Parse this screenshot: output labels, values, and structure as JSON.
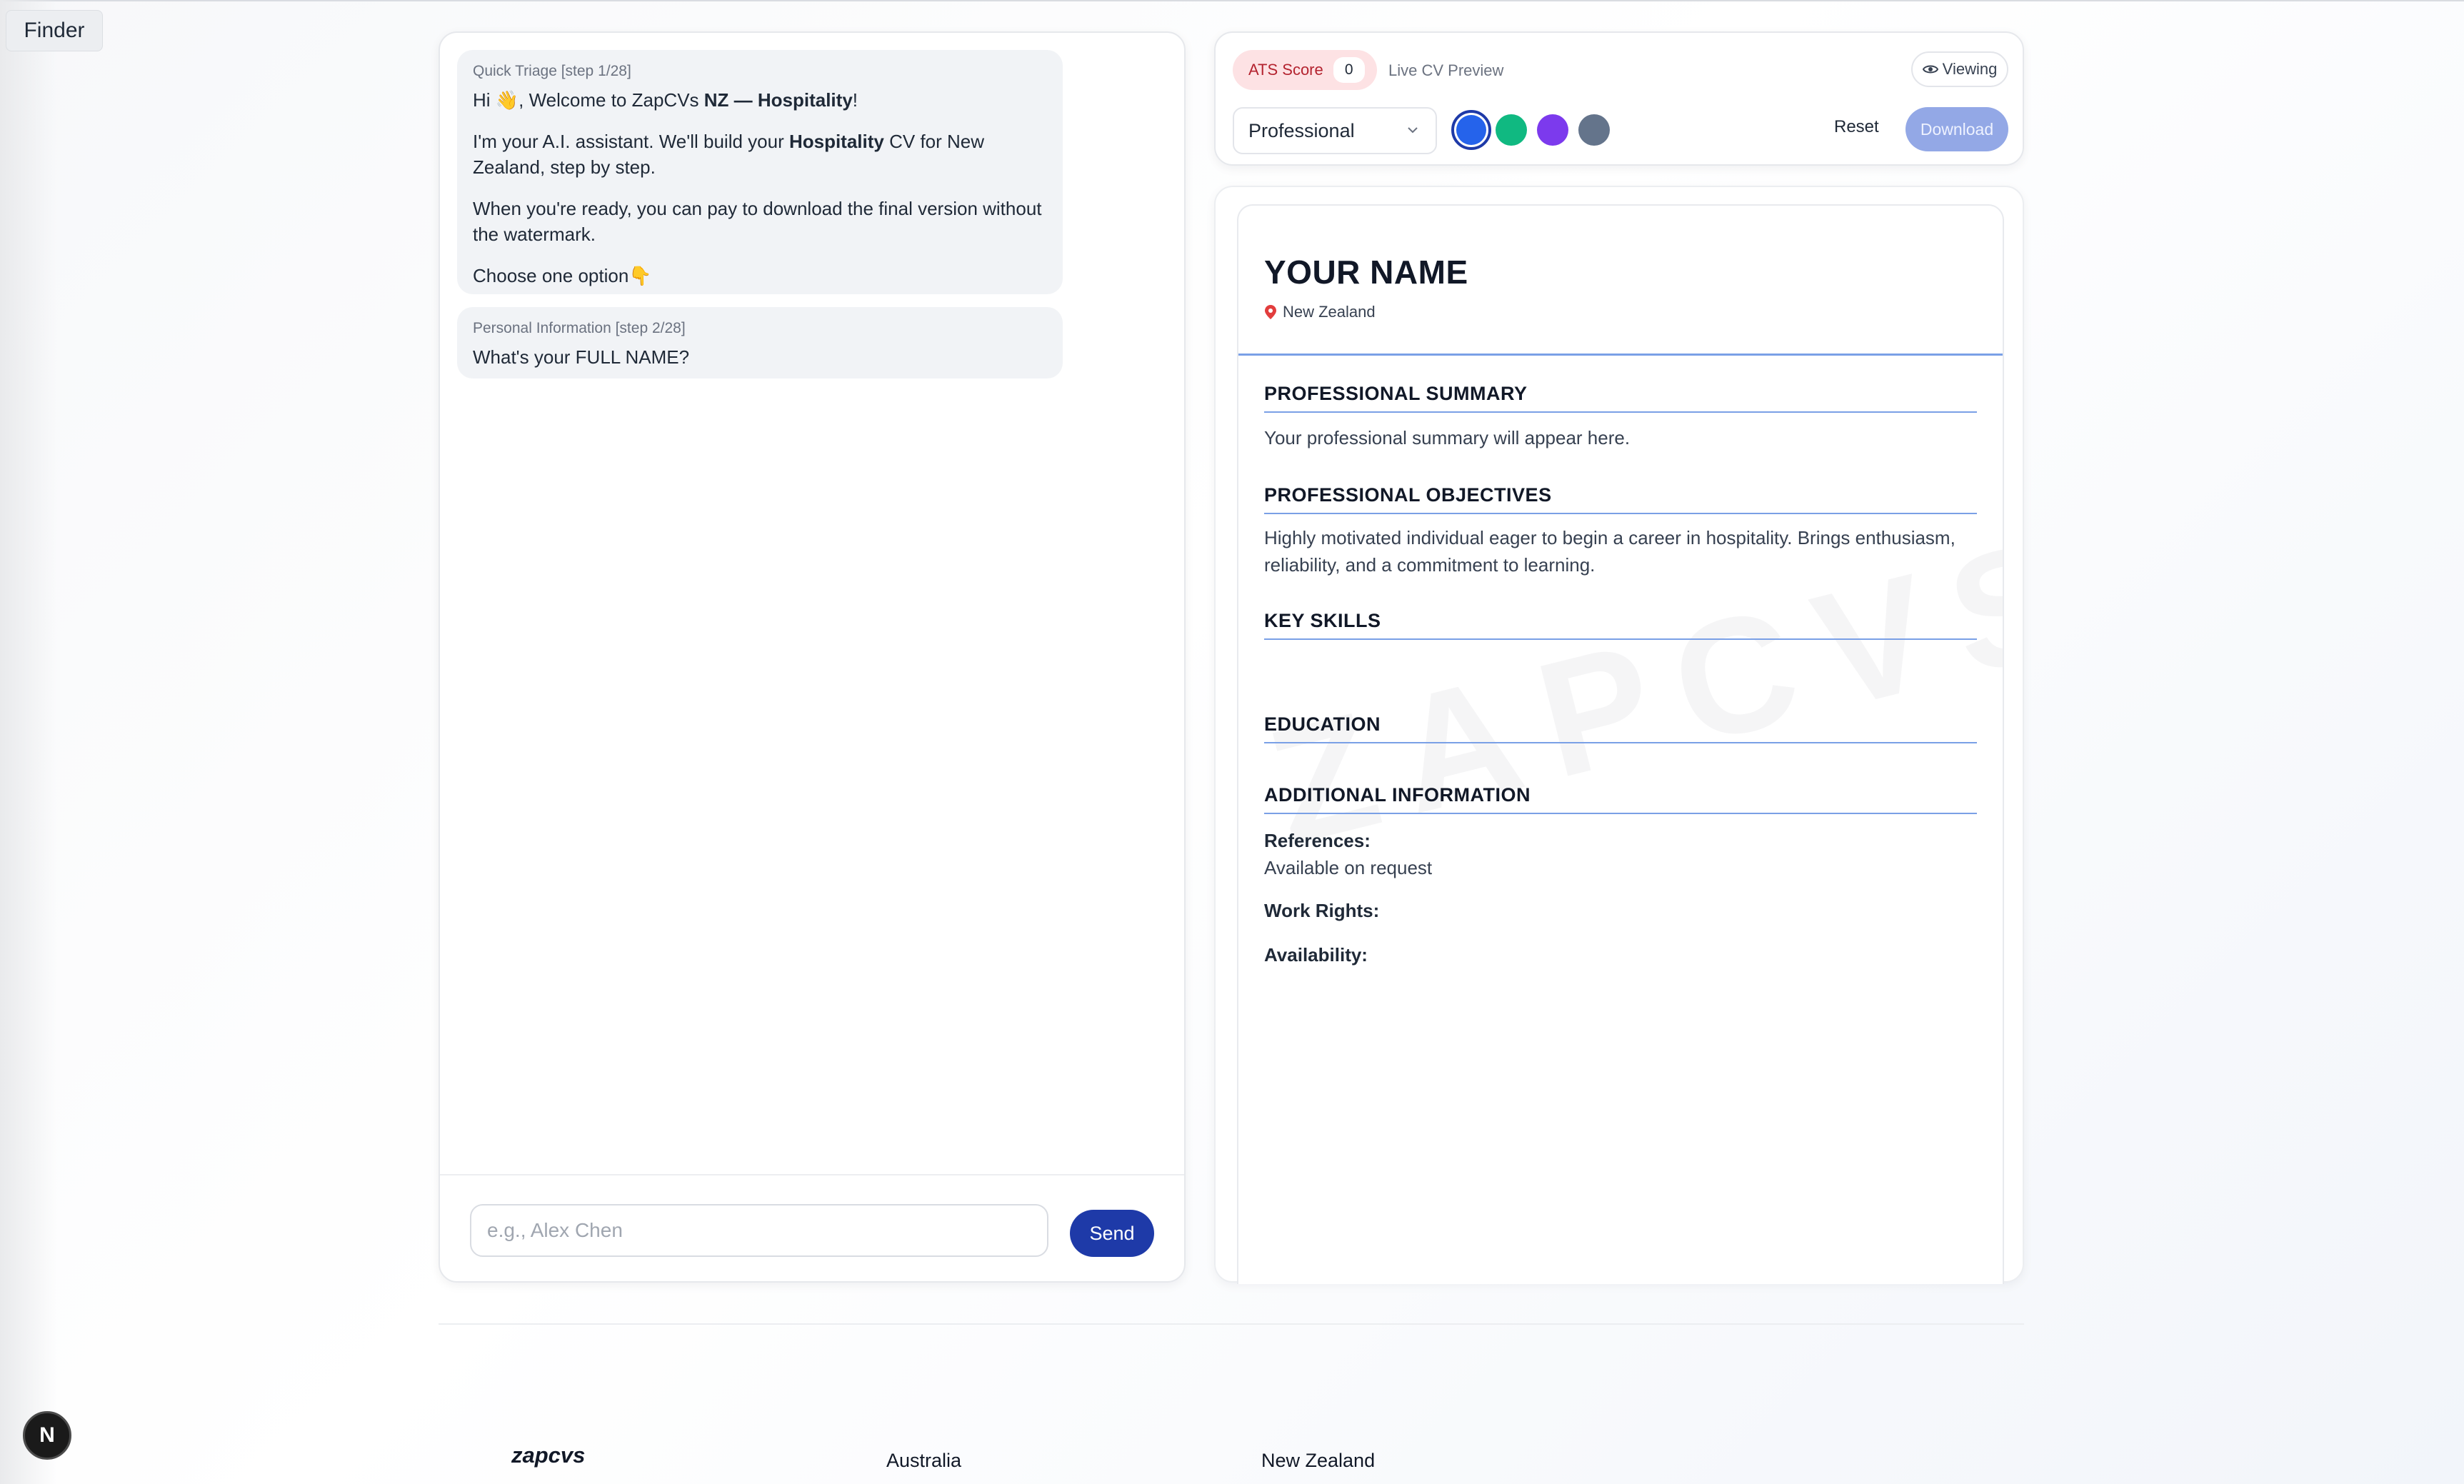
{
  "system": {
    "finder_label": "Finder"
  },
  "chat": {
    "messages": [
      {
        "step": "Quick Triage [step 1/28]",
        "greeting_pre": "Hi 👋, Welcome to ZapCVs ",
        "greeting_bold": "NZ — Hospitality",
        "greeting_post": "!",
        "line2_pre": "I'm your A.I. assistant. We'll build your ",
        "line2_bold": "Hospitality",
        "line2_post": " CV for New Zealand, step by step.",
        "line3": "When you're ready, you can pay to download the final version without the watermark.",
        "line4": "Choose one option👇"
      },
      {
        "step": "Personal Information [step 2/28]",
        "question": "What's your FULL NAME?"
      }
    ],
    "input_placeholder": "e.g., Alex Chen",
    "input_value": "",
    "send_label": "Send"
  },
  "toolbar": {
    "ats_label": "ATS Score",
    "ats_score": "0",
    "live_label": "Live CV Preview",
    "viewing_label": "Viewing",
    "template_selected": "Professional",
    "colors": [
      "#2563eb",
      "#10b981",
      "#7c3aed",
      "#64748b"
    ],
    "selected_color": "#2563eb",
    "reset_label": "Reset",
    "download_label": "Download"
  },
  "cv": {
    "name": "YOUR NAME",
    "location": "New Zealand",
    "watermark": "ZAPCVS",
    "summary_title": "PROFESSIONAL SUMMARY",
    "summary_text": "Your professional summary will appear here.",
    "objectives_title": "PROFESSIONAL OBJECTIVES",
    "objectives_text": "Highly motivated individual eager to begin a career in hospitality. Brings enthusiasm, reliability, and a commitment to learning.",
    "skills_title": "KEY SKILLS",
    "education_title": "EDUCATION",
    "additional_title": "ADDITIONAL INFORMATION",
    "references_label": "References:",
    "references_value": "Available on request",
    "work_rights_label": "Work Rights:",
    "availability_label": "Availability:"
  },
  "footer": {
    "logo": "zapcvs",
    "col1": "Australia",
    "col2": "New Zealand",
    "badge": "N"
  }
}
